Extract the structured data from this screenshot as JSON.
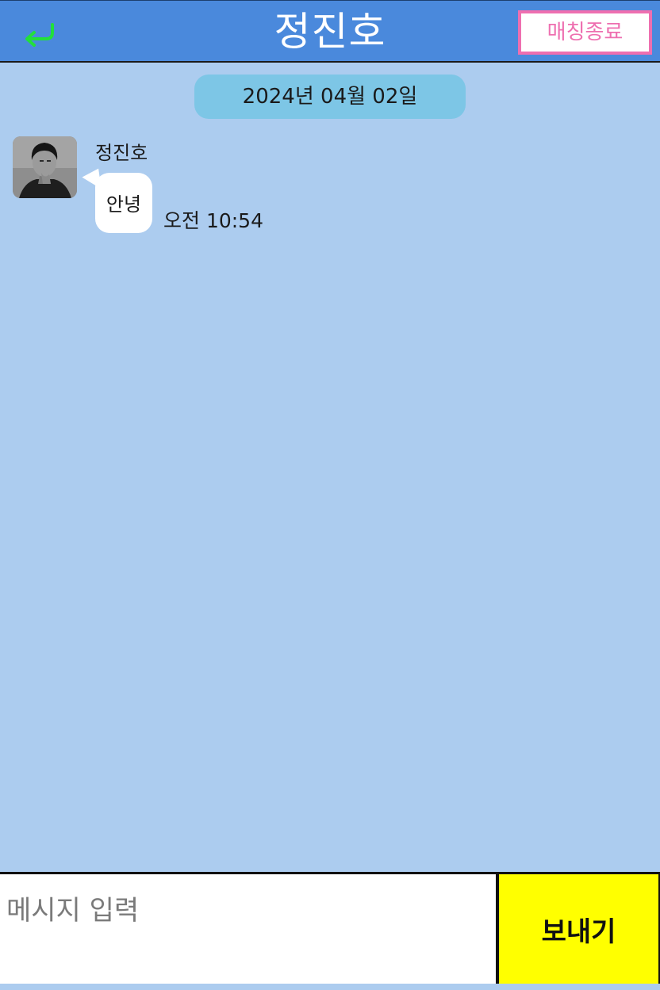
{
  "header": {
    "title": "정진호",
    "back_icon": "return-arrow-icon",
    "end_button_label": "매칭종료",
    "background_color": "#4a89dc",
    "back_icon_color": "#22e03a",
    "end_button_color": "#ee6fb0"
  },
  "chat": {
    "date_label": "2024년 04월 02일",
    "background_color": "#acccef",
    "messages": [
      {
        "sender": "정진호",
        "avatar": "profile-photo",
        "text": "안녕",
        "time": "오전 10:54"
      }
    ]
  },
  "composer": {
    "placeholder": "메시지 입력",
    "send_label": "보내기",
    "send_color": "#ffff00"
  }
}
